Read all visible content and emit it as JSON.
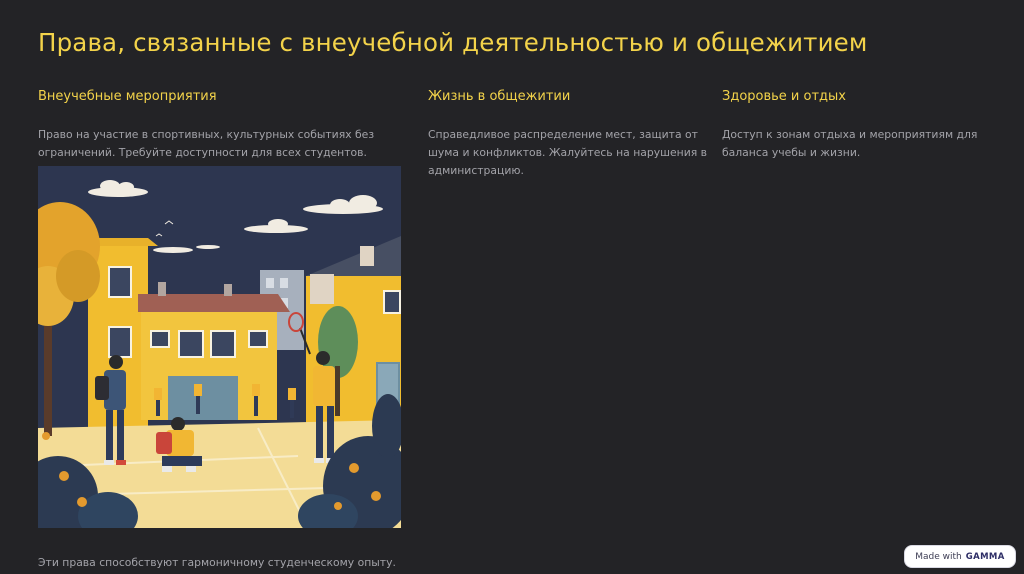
{
  "slide": {
    "title": "Права, связанные с внеучебной деятельностью и общежитием",
    "columns": [
      {
        "heading": "Внеучебные мероприятия",
        "text": "Право на участие в спортивных, культурных событиях без ограничений. Требуйте доступности для всех студентов."
      },
      {
        "heading": "Жизнь в общежитии",
        "text": "Справедливое распределение мест, защита от шума и конфликтов. Жалуйтесь на нарушения в администрацию."
      },
      {
        "heading": "Здоровье и отдых",
        "text": "Доступ к зонам отдыха и мероприятиям для баланса учебы и жизни."
      }
    ],
    "footer": "Эти права способствуют гармоничному студенческому опыту."
  },
  "badge": {
    "prefix": "Made with",
    "brand": "GAMMA"
  },
  "colors": {
    "background": "#232326",
    "accent": "#f3d34a",
    "body_text": "#a3a3a9"
  }
}
